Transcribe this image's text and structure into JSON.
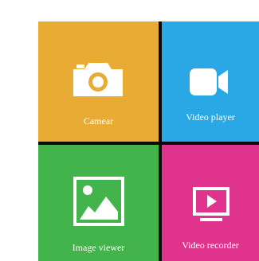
{
  "tiles": [
    {
      "label": "Camear",
      "icon": "camera-icon",
      "color": "#e8ab34"
    },
    {
      "label": "Video player",
      "icon": "video-camera-icon",
      "color": "#2aa8e6"
    },
    {
      "label": "Image viewer",
      "icon": "image-icon",
      "color": "#43b34b"
    },
    {
      "label": "Video recorder",
      "icon": "play-screen-icon",
      "color": "#e0338e"
    }
  ],
  "colors": {
    "separator": "#0b0b0b",
    "icon_foreground": "#ffffff",
    "background": "#ffffff"
  }
}
